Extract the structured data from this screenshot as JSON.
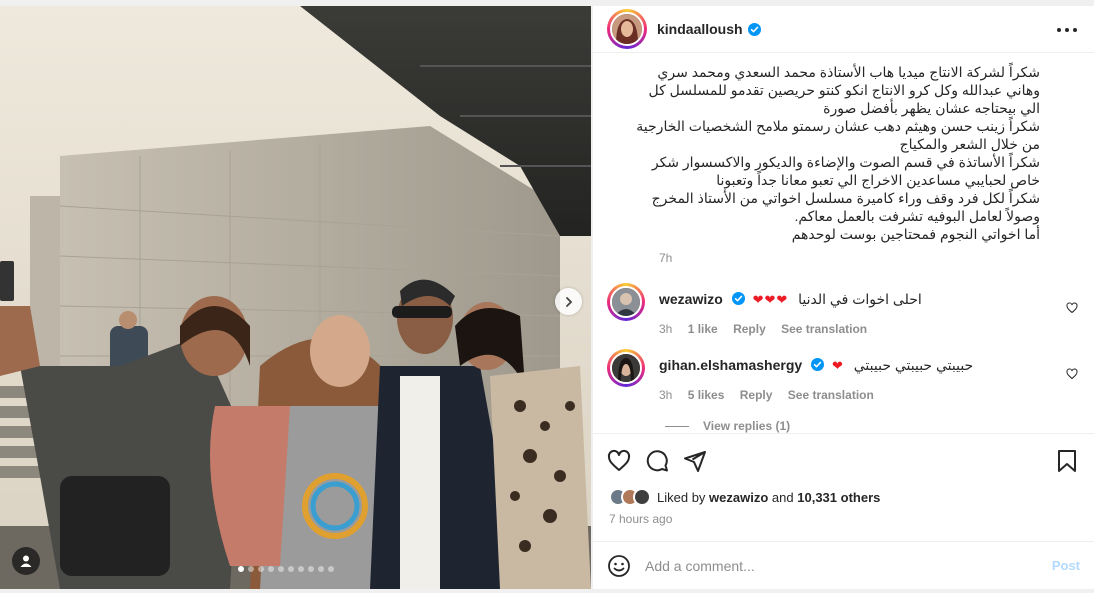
{
  "post": {
    "username": "kindaalloush",
    "caption": "شكراً لشركة الانتاج ميديا هاب الأستاذة محمد السعدي ومحمد سري\nوهاني عبدالله وكل كرو الانتاج انكو كنتو حريصين تقدمو للمسلسل كل\nالي بيحتاجه عشان يظهر بأفضل صورة\nشكراً زينب حسن وهيثم دهب عشان رسمتو ملامح الشخصيات الخارجية\nمن خلال الشعر والمكياج\nشكراً الأساتذة في قسم الصوت والإضاءة والديكور والاكسسوار شكر\nخاص لحبايبي مساعدين الاخراج الي تعبو معانا جداً وتعبونا\nشكراً لكل فرد وقف وراء كاميرة مسلسل اخواتي من الأستاذ المخرج\nوصولاً لعامل البوفيه تشرفت بالعمل معاكم.\nأما اخواتي النجوم فمحتاجين بوست لوحدهم",
    "caption_time": "7h",
    "liked_by_prefix": "Liked by",
    "liked_by_user": "wezawizo",
    "liked_by_and": "and",
    "liked_by_others": "10,331 others",
    "post_time": "7 hours ago",
    "carousel_count": 10,
    "carousel_active": 0
  },
  "comments": [
    {
      "username": "wezawizo",
      "text": "احلى اخوات في الدنيا",
      "hearts": "❤❤❤",
      "time": "3h",
      "likes": "1 like",
      "reply": "Reply",
      "translate": "See translation"
    },
    {
      "username": "gihan.elshamashergy",
      "text": "حبيبتي حبيبتي حبيبتي",
      "hearts": "❤",
      "time": "3h",
      "likes": "5 likes",
      "reply": "Reply",
      "translate": "See translation"
    }
  ],
  "view_replies": "View replies (1)",
  "comment_box": {
    "placeholder": "Add a comment...",
    "post_label": "Post"
  },
  "icons": {
    "more": "more-options-icon",
    "like": "heart-icon",
    "comment": "comment-icon",
    "share": "share-icon",
    "save": "bookmark-icon",
    "emoji": "emoji-icon",
    "next": "chevron-right-icon",
    "tags": "user-tag-icon"
  },
  "colors": {
    "verified": "#0095f6",
    "heart": "#ed1c24",
    "post_disabled": "#b3dbff",
    "muted_text": "#8e8e8e"
  }
}
